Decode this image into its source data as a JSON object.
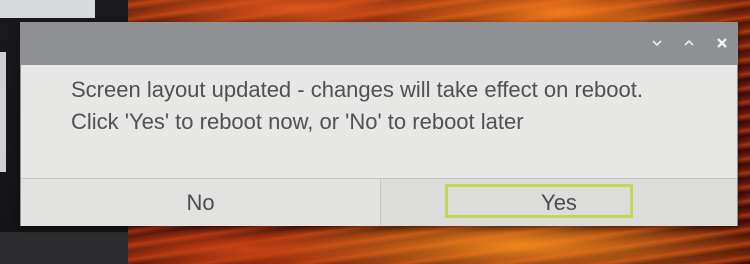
{
  "dialog": {
    "titlebar_controls": {
      "minimize_icon": "chevron-down-icon",
      "maximize_icon": "chevron-up-icon",
      "close_icon": "close-icon"
    },
    "message_lines": [
      "Screen layout updated - changes will take effect on reboot.",
      "Click 'Yes' to reboot now, or 'No' to reboot later"
    ],
    "buttons": {
      "no_label": "No",
      "yes_label": "Yes"
    },
    "focused_button": "Yes",
    "colors": {
      "titlebar": "#8e9093",
      "dialog_background": "#e7e8e6",
      "focus_ring": "#c2d65a",
      "text": "#4f5152"
    }
  }
}
